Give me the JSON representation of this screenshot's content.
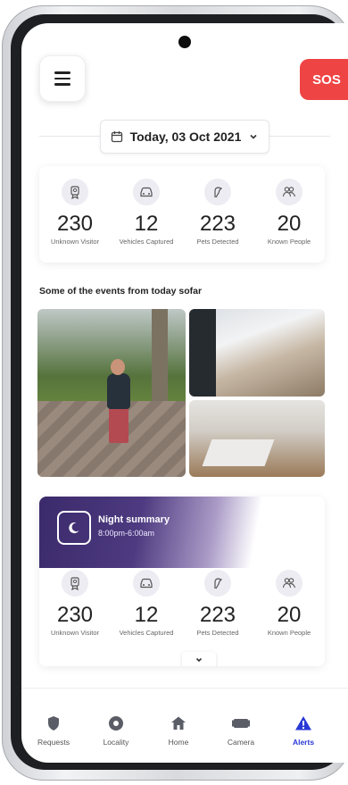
{
  "header": {
    "sos_label": "SOS"
  },
  "date_selector": {
    "label": "Today, 03 Oct 2021"
  },
  "today_stats": [
    {
      "icon": "badge-icon",
      "value": "230",
      "label": "Unknown Visitor"
    },
    {
      "icon": "car-icon",
      "value": "12",
      "label": "Vehicles Captured"
    },
    {
      "icon": "pet-icon",
      "value": "223",
      "label": "Pets Detected"
    },
    {
      "icon": "people-icon",
      "value": "20",
      "label": "Known People"
    }
  ],
  "events": {
    "title": "Some of the events from today sofar"
  },
  "night_summary": {
    "title": "Night summary",
    "time_range": "8:00pm-6:00am",
    "stats": [
      {
        "icon": "badge-icon",
        "value": "230",
        "label": "Unknown Visitor"
      },
      {
        "icon": "car-icon",
        "value": "12",
        "label": "Vehicles Captured"
      },
      {
        "icon": "pet-icon",
        "value": "223",
        "label": "Pets Detected"
      },
      {
        "icon": "people-icon",
        "value": "20",
        "label": "Known People"
      }
    ]
  },
  "bottom_nav": [
    {
      "icon": "shield-icon",
      "label": "Requests"
    },
    {
      "icon": "locality-icon",
      "label": "Locality"
    },
    {
      "icon": "home-icon",
      "label": "Home"
    },
    {
      "icon": "camera-icon",
      "label": "Camera"
    },
    {
      "icon": "alert-icon",
      "label": "Alerts",
      "active": true
    }
  ],
  "colors": {
    "sos": "#ef4444",
    "active_nav": "#2a39d6",
    "night_gradient": "#3b2a6b"
  }
}
